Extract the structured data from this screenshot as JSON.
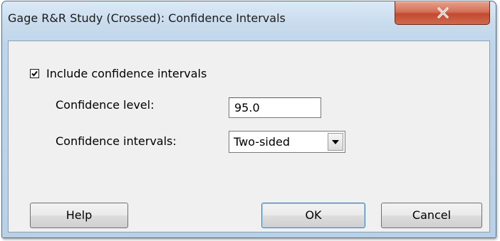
{
  "window": {
    "title": "Gage R&R Study (Crossed): Confidence Intervals"
  },
  "options": {
    "include_ci_label": "Include confidence intervals",
    "include_ci_checked": true,
    "confidence_level_label": "Confidence level:",
    "confidence_level_value": "95.0",
    "confidence_intervals_label": "Confidence intervals:",
    "confidence_intervals_value": "Two-sided"
  },
  "buttons": {
    "help": "Help",
    "ok": "OK",
    "cancel": "Cancel"
  },
  "icons": {
    "close": "close-icon",
    "check": "check-icon",
    "dropdown": "chevron-down-icon"
  }
}
